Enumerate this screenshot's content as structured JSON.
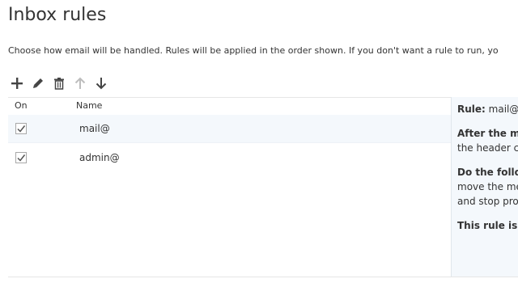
{
  "page": {
    "title": "Inbox rules",
    "description": "Choose how email will be handled. Rules will be applied in the order shown. If you don't want a rule to run, yo"
  },
  "toolbar": {
    "buttons": [
      {
        "icon": "plus-icon"
      },
      {
        "icon": "pencil-icon"
      },
      {
        "icon": "trash-icon"
      },
      {
        "icon": "arrow-up-icon"
      },
      {
        "icon": "arrow-down-icon"
      }
    ]
  },
  "table": {
    "columns": {
      "on": "On",
      "name": "Name"
    },
    "rows": [
      {
        "name": "mail@",
        "enabled": true,
        "selected": true
      },
      {
        "name": "admin@",
        "enabled": true,
        "selected": false
      }
    ]
  },
  "detail": {
    "rule_label": "Rule:",
    "rule_value": "mail@",
    "after_heading": "After the me",
    "after_text": "the header c",
    "do_heading": "Do the follo",
    "do_line1": "move the me",
    "do_line2": "and stop pro",
    "status_label": "This rule is:"
  },
  "colors": {
    "selected_row": "#f4f8fc",
    "icon_active": "#444444",
    "icon_disabled": "#bdbdbd"
  }
}
